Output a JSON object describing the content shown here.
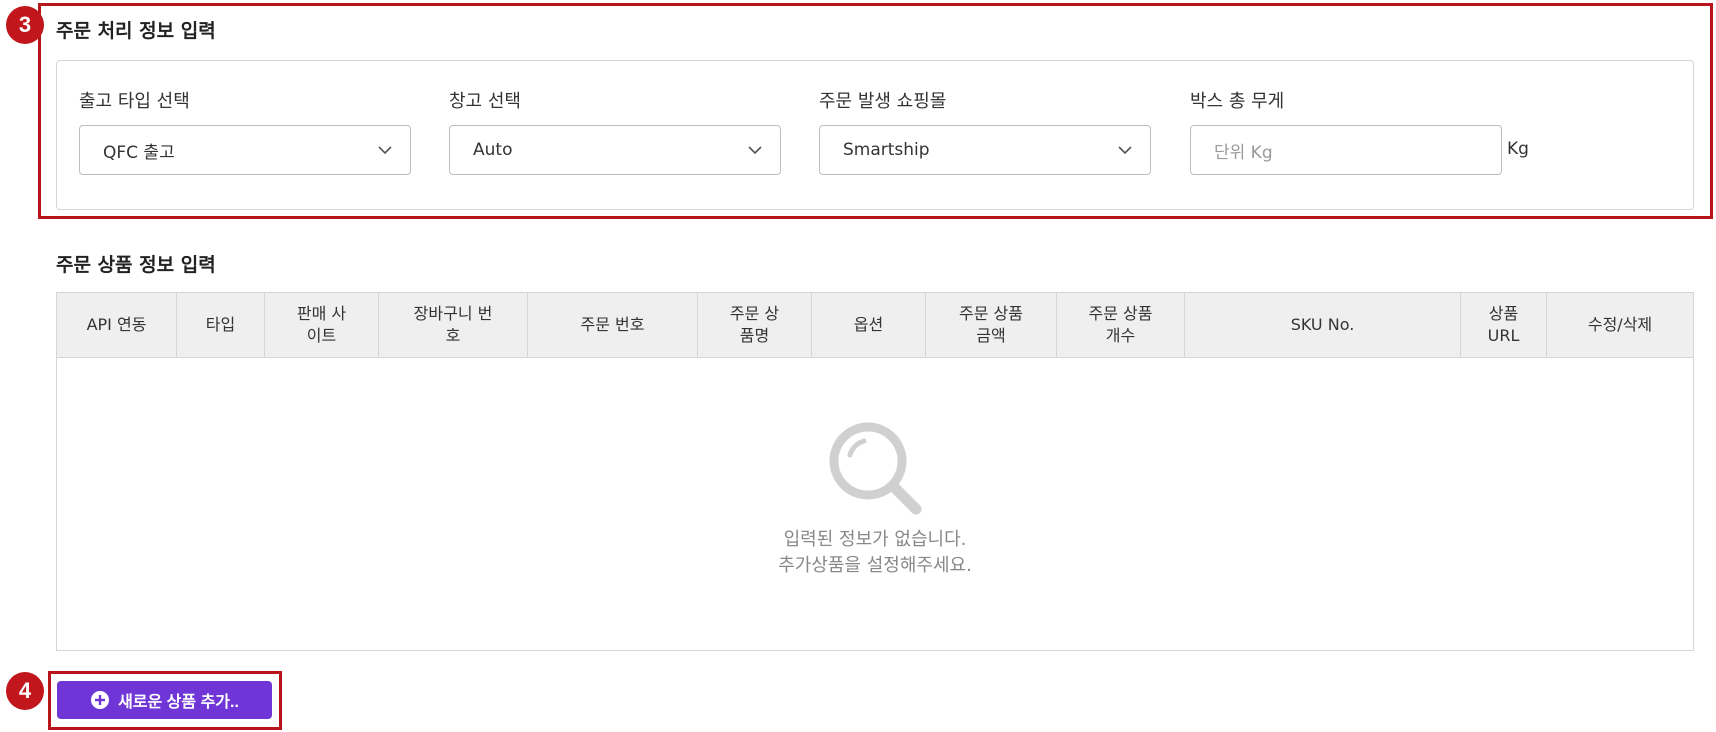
{
  "badges": {
    "step3": "3",
    "step4": "4"
  },
  "order_processing": {
    "title": "주문 처리 정보 입력",
    "fields": [
      {
        "label": "출고 타입 선택",
        "value": "QFC 출고"
      },
      {
        "label": "창고 선택",
        "value": "Auto"
      },
      {
        "label": "주문 발생 쇼핑몰",
        "value": "Smartship"
      },
      {
        "label": "박스 총 무게",
        "placeholder": "단위 Kg",
        "unit": "Kg"
      }
    ]
  },
  "order_products": {
    "title": "주문 상품 정보 입력",
    "columns": [
      "API 연동",
      "타입",
      "판매 사\n이트",
      "장바구니 번\n호",
      "주문 번호",
      "주문 상\n품명",
      "옵션",
      "주문 상품\n금액",
      "주문 상품\n개수",
      "SKU No.",
      "상품\nURL",
      "수정/삭제"
    ],
    "empty_line_1": "입력된 정보가 없습니다.",
    "empty_line_2": "추가상품을 설정해주세요."
  },
  "add_button": {
    "label": "새로운 상품 추가.."
  },
  "colors": {
    "accent": "#6f35d6",
    "highlight": "#b8141b",
    "header_bg": "#efefef"
  },
  "icons": {
    "select_arrow": "chevron-down-icon",
    "empty": "magnifier-icon",
    "add": "plus-circle-icon"
  }
}
